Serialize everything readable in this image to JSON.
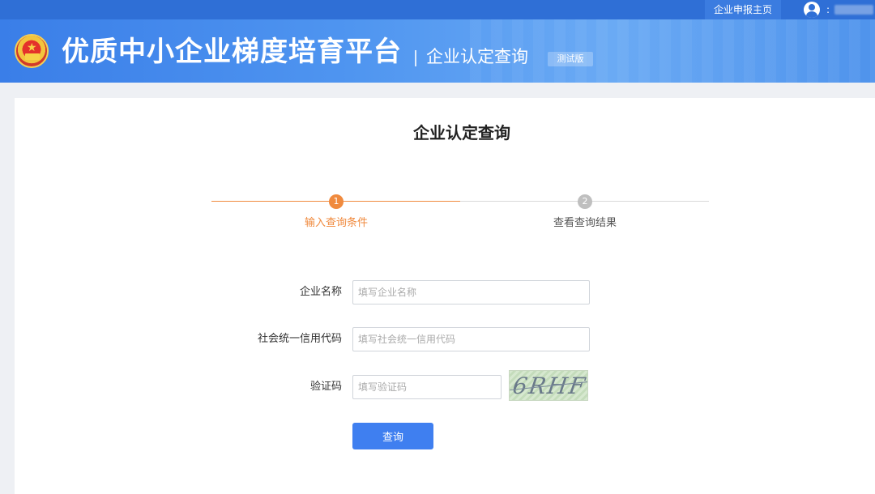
{
  "topbar": {
    "home_link": "企业申报主页",
    "user_separator": ":"
  },
  "header": {
    "site_title": "优质中小企业梯度培育平台",
    "sub_title": "企业认定查询",
    "beta_badge": "测试版"
  },
  "page": {
    "title": "企业认定查询"
  },
  "steps": [
    {
      "number": "1",
      "label": "输入查询条件",
      "status": "active"
    },
    {
      "number": "2",
      "label": "查看查询结果",
      "status": "inactive"
    }
  ],
  "form": {
    "company_name": {
      "label": "企业名称",
      "placeholder": "填写企业名称",
      "value": ""
    },
    "credit_code": {
      "label": "社会统一信用代码",
      "placeholder": "填写社会统一信用代码",
      "value": ""
    },
    "captcha": {
      "label": "验证码",
      "placeholder": "填写验证码",
      "value": "",
      "image_text": "6RHF"
    },
    "submit_label": "查询"
  },
  "colors": {
    "topbar": "#2f6fd6",
    "accent_orange": "#f08a3e",
    "primary_button": "#3f7ff0"
  }
}
